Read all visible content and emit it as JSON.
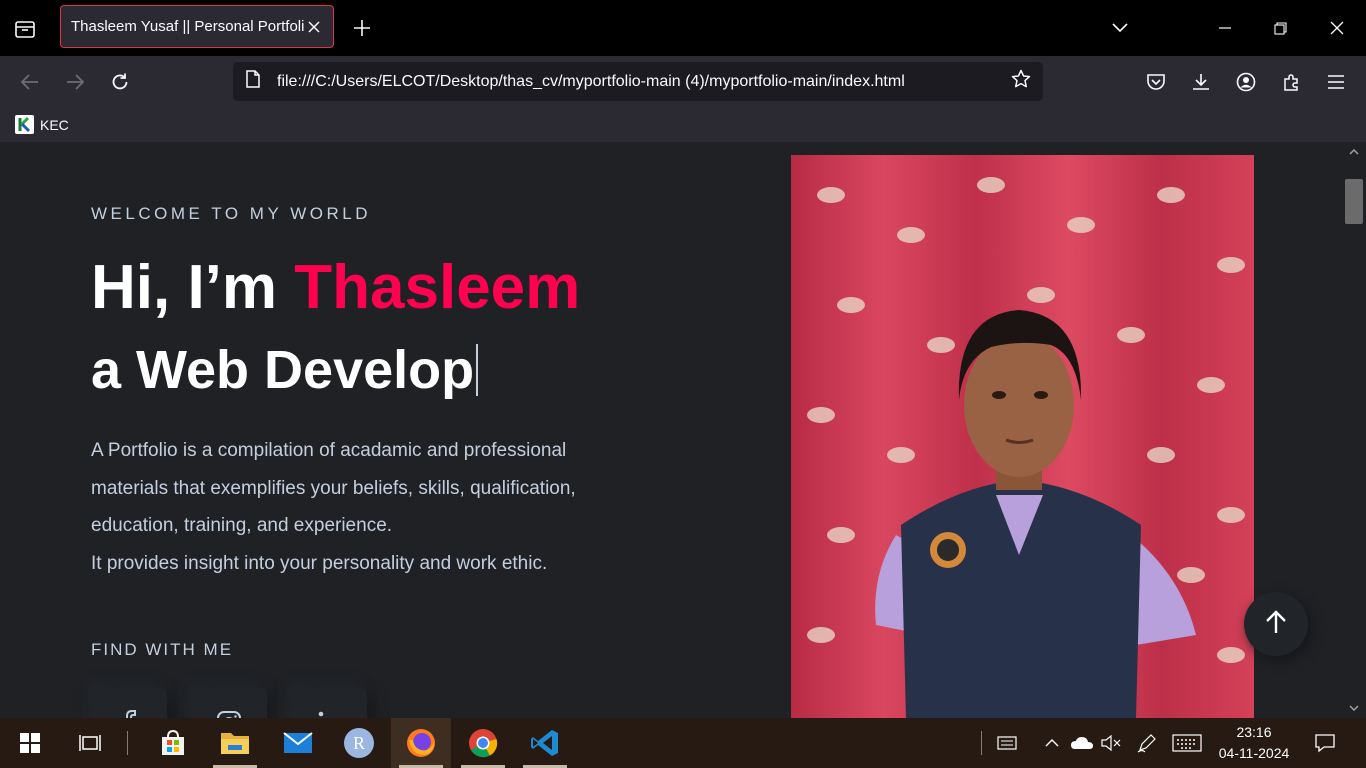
{
  "browser": {
    "tab": {
      "title": "Thasleem Yusaf || Personal Portfolio"
    },
    "url": "file:///C:/Users/ELCOT/Desktop/thas_cv/myportfolio-main (4)/myportfolio-main/index.html",
    "bookmarks": [
      {
        "label": "KEC"
      }
    ],
    "icons": {
      "tab_list": "list-all-tabs-icon",
      "close_tab": "close-icon",
      "new_tab": "plus-icon",
      "tab_overflow": "chevron-down-icon",
      "minimize": "minimize-icon",
      "restore": "restore-icon",
      "close_window": "close-icon",
      "back": "back-arrow-icon",
      "forward": "forward-arrow-icon",
      "reload": "reload-icon",
      "page": "file-icon",
      "bookmark": "star-icon",
      "pocket": "pocket-icon",
      "downloads": "download-icon",
      "account": "account-icon",
      "extensions": "extensions-icon",
      "menu": "hamburger-menu-icon"
    }
  },
  "hero": {
    "welcome": "WELCOME TO MY WORLD",
    "greeting": "Hi, I’m ",
    "name": "Thasleem",
    "typed": "a Web Develop",
    "description": [
      "A Portfolio is a compilation of acadamic and professional materials that exemplifies your beliefs, skills, qualification, education, training, and experience.",
      "It provides insight into your personality and work ethic."
    ],
    "find_with_me": "FIND WITH ME",
    "social_icons": [
      "facebook-icon",
      "instagram-icon",
      "linkedin-icon"
    ],
    "photo": "profile-photo",
    "accent_color": "#ff014f"
  },
  "scroll_top": {
    "icon": "arrow-up-icon"
  },
  "taskbar": {
    "apps": [
      "windows-start-icon",
      "task-view-icon",
      "microsoft-store-icon",
      "file-explorer-icon",
      "mail-icon",
      "r-app-icon",
      "firefox-icon",
      "chrome-icon",
      "vscode-icon"
    ],
    "tray_icons": [
      "keyboard-icon",
      "chevron-up-icon",
      "onedrive-icon",
      "speaker-muted-icon",
      "pen-icon",
      "touch-keyboard-icon",
      "notification-icon"
    ],
    "time": "23:16",
    "date": "04-11-2024"
  }
}
